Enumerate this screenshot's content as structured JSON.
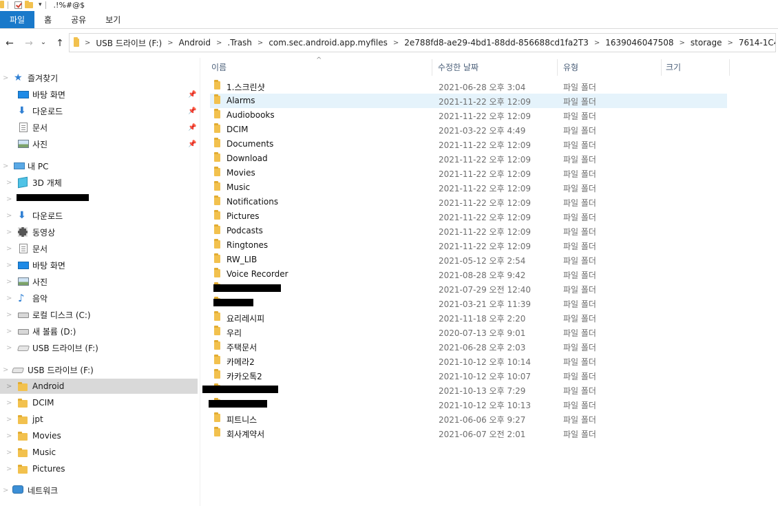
{
  "titlebar": {
    "title": ".!%#@$",
    "qat_dropdown": "▾"
  },
  "ribbon": {
    "tabs": [
      {
        "label": "파일",
        "active": true
      },
      {
        "label": "홈",
        "active": false
      },
      {
        "label": "공유",
        "active": false
      },
      {
        "label": "보기",
        "active": false
      }
    ]
  },
  "nav": {
    "back": "←",
    "forward": "→",
    "recent": "⌄",
    "up": "↑"
  },
  "address": {
    "breadcrumbs": [
      "USB 드라이브 (F:)",
      "Android",
      ".Trash",
      "com.sec.android.app.myfiles",
      "2e788fd8-ae29-4bd1-88dd-856688cd1fa2T3",
      "1639046047508",
      "storage",
      "7614-1C46",
      ".!%#@$"
    ]
  },
  "sidebar": {
    "quick_access": {
      "label": "즐겨찾기",
      "items": [
        {
          "label": "바탕 화면",
          "icon": "desktop-icon",
          "pinned": true
        },
        {
          "label": "다운로드",
          "icon": "download-icon",
          "pinned": true
        },
        {
          "label": "문서",
          "icon": "document-icon",
          "pinned": true
        },
        {
          "label": "사진",
          "icon": "picture-icon",
          "pinned": true
        }
      ]
    },
    "this_pc": {
      "label": "내 PC",
      "items": [
        {
          "label": "3D 개체",
          "icon": "3d-objects-icon"
        },
        {
          "label": "",
          "icon": "redacted",
          "redacted": true
        },
        {
          "label": "다운로드",
          "icon": "download-icon"
        },
        {
          "label": "동영상",
          "icon": "video-icon"
        },
        {
          "label": "문서",
          "icon": "document-icon"
        },
        {
          "label": "바탕 화면",
          "icon": "desktop-icon"
        },
        {
          "label": "사진",
          "icon": "picture-icon"
        },
        {
          "label": "음악",
          "icon": "music-icon"
        },
        {
          "label": "로컬 디스크 (C:)",
          "icon": "drive-icon"
        },
        {
          "label": "새 볼륨 (D:)",
          "icon": "drive-icon"
        },
        {
          "label": "USB 드라이브 (F:)",
          "icon": "usb-drive-icon"
        }
      ]
    },
    "usb": {
      "label": "USB 드라이브 (F:)",
      "items": [
        {
          "label": "Android",
          "selected": true
        },
        {
          "label": "DCIM"
        },
        {
          "label": "jpt"
        },
        {
          "label": "Movies"
        },
        {
          "label": "Music"
        },
        {
          "label": "Pictures"
        }
      ]
    },
    "network": {
      "label": "네트워크"
    },
    "pin_glyph": "📌"
  },
  "table": {
    "sort_glyph": "^",
    "columns": {
      "name": "이름",
      "modified": "수정한 날짜",
      "type": "유형",
      "size": "크기"
    },
    "rows": [
      {
        "name": "1.스크린샷",
        "modified": "2021-06-28 오후 3:04",
        "type": "파일 폴더"
      },
      {
        "name": "Alarms",
        "modified": "2021-11-22 오후 12:09",
        "type": "파일 폴더",
        "highlight": true
      },
      {
        "name": "Audiobooks",
        "modified": "2021-11-22 오후 12:09",
        "type": "파일 폴더"
      },
      {
        "name": "DCIM",
        "modified": "2021-03-22 오후 4:49",
        "type": "파일 폴더"
      },
      {
        "name": "Documents",
        "modified": "2021-11-22 오후 12:09",
        "type": "파일 폴더"
      },
      {
        "name": "Download",
        "modified": "2021-11-22 오후 12:09",
        "type": "파일 폴더"
      },
      {
        "name": "Movies",
        "modified": "2021-11-22 오후 12:09",
        "type": "파일 폴더"
      },
      {
        "name": "Music",
        "modified": "2021-11-22 오후 12:09",
        "type": "파일 폴더"
      },
      {
        "name": "Notifications",
        "modified": "2021-11-22 오후 12:09",
        "type": "파일 폴더"
      },
      {
        "name": "Pictures",
        "modified": "2021-11-22 오후 12:09",
        "type": "파일 폴더"
      },
      {
        "name": "Podcasts",
        "modified": "2021-11-22 오후 12:09",
        "type": "파일 폴더"
      },
      {
        "name": "Ringtones",
        "modified": "2021-11-22 오후 12:09",
        "type": "파일 폴더"
      },
      {
        "name": "RW_LIB",
        "modified": "2021-05-12 오후 2:54",
        "type": "파일 폴더"
      },
      {
        "name": "Voice Recorder",
        "modified": "2021-08-28 오후 9:42",
        "type": "파일 폴더"
      },
      {
        "name": "",
        "modified": "2021-07-29 오전 12:40",
        "type": "파일 폴더",
        "redacted": true
      },
      {
        "name": "",
        "modified": "2021-03-21 오후 11:39",
        "type": "파일 폴더",
        "redacted": true
      },
      {
        "name": "요리레시피",
        "modified": "2021-11-18 오후 2:20",
        "type": "파일 폴더"
      },
      {
        "name": "우리",
        "modified": "2020-07-13 오후 9:01",
        "type": "파일 폴더"
      },
      {
        "name": "주택문서",
        "modified": "2021-06-28 오후 2:03",
        "type": "파일 폴더"
      },
      {
        "name": "카메라2",
        "modified": "2021-10-12 오후 10:14",
        "type": "파일 폴더"
      },
      {
        "name": "카카오톡2",
        "modified": "2021-10-12 오후 10:07",
        "type": "파일 폴더"
      },
      {
        "name": "",
        "modified": "2021-10-13 오후 7:29",
        "type": "파일 폴더",
        "redacted": true
      },
      {
        "name": "",
        "modified": "2021-10-12 오후 10:13",
        "type": "파일 폴더",
        "redacted": true
      },
      {
        "name": "피트니스",
        "modified": "2021-06-06 오후 9:27",
        "type": "파일 폴더"
      },
      {
        "name": "회사계약서",
        "modified": "2021-06-07 오전 2:01",
        "type": "파일 폴더"
      }
    ]
  }
}
